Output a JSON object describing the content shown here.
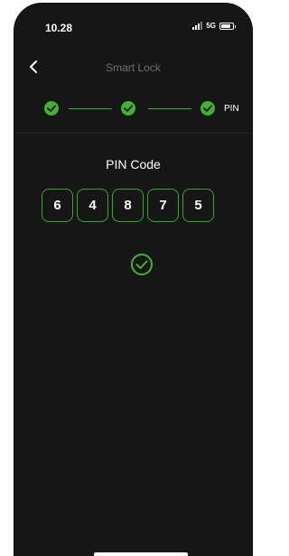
{
  "status_bar": {
    "time": "10.28",
    "network": "5G",
    "icons": [
      "signal-icon",
      "battery-icon"
    ],
    "battery_level": 0.85
  },
  "nav": {
    "title": "Smart Lock",
    "back_icon": "chevron-left-icon"
  },
  "stepper": {
    "steps": [
      {
        "state": "completed",
        "icon": "check-circle-icon"
      },
      {
        "state": "completed",
        "icon": "check-circle-icon"
      },
      {
        "state": "current",
        "icon": "check-circle-icon",
        "label": "PIN"
      }
    ]
  },
  "pin": {
    "title": "PIN Code",
    "digits": [
      "6",
      "4",
      "8",
      "7",
      "5"
    ]
  },
  "status": {
    "icon": "check-circle-icon"
  },
  "colors": {
    "background": "#161616",
    "accent": "#3fb62c",
    "muted_text": "#6f6f6f",
    "text": "#ffffff"
  }
}
